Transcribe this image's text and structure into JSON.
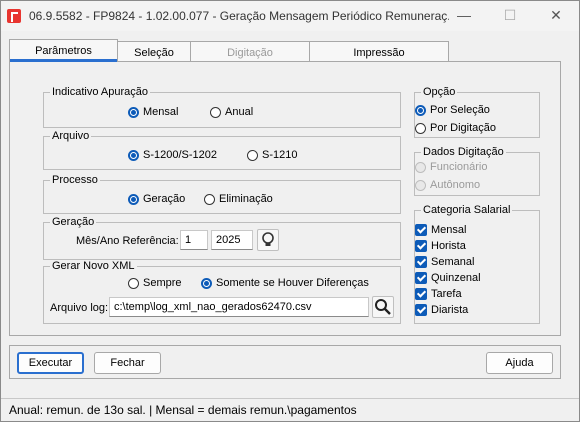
{
  "window": {
    "title": "06.9.5582 - FP9824 - 1.02.00.077 - Geração Mensagem Periódico Remuneraç...",
    "minimize": "—",
    "maximize": "☐",
    "close": "✕"
  },
  "tabs": [
    {
      "label": "Parâmetros",
      "state": "active"
    },
    {
      "label": "Seleção",
      "state": "normal"
    },
    {
      "label": "Digitação",
      "state": "disabled"
    },
    {
      "label": "Impressão",
      "state": "normal"
    }
  ],
  "indicativo": {
    "legend": "Indicativo Apuração",
    "options": [
      {
        "label": "Mensal",
        "selected": true
      },
      {
        "label": "Anual",
        "selected": false
      }
    ]
  },
  "arquivo": {
    "legend": "Arquivo",
    "options": [
      {
        "label": "S-1200/S-1202",
        "selected": true
      },
      {
        "label": "S-1210",
        "selected": false
      }
    ]
  },
  "processo": {
    "legend": "Processo",
    "options": [
      {
        "label": "Geração",
        "selected": true
      },
      {
        "label": "Eliminação",
        "selected": false
      }
    ]
  },
  "geracao": {
    "legend": "Geração",
    "ref_label": "Mês/Ano Referência:",
    "month": "1",
    "year": "2025",
    "lookup_icon": "bulb-icon"
  },
  "xml": {
    "legend": "Gerar Novo XML",
    "options": [
      {
        "label": "Sempre",
        "selected": false
      },
      {
        "label": "Somente se Houver Diferenças",
        "selected": true
      }
    ],
    "log_label": "Arquivo log:",
    "log_path": "c:\\temp\\log_xml_nao_gerados62470.csv",
    "search_icon": "search-icon"
  },
  "opcao": {
    "legend": "Opção",
    "options": [
      {
        "label": "Por Seleção",
        "selected": true
      },
      {
        "label": "Por Digitação",
        "selected": false
      }
    ]
  },
  "dados": {
    "legend": "Dados Digitação",
    "options": [
      {
        "label": "Funcionário",
        "selected": true,
        "disabled": true
      },
      {
        "label": "Autônomo",
        "selected": false,
        "disabled": true
      }
    ]
  },
  "categoria": {
    "legend": "Categoria Salarial",
    "items": [
      {
        "label": "Mensal",
        "checked": true
      },
      {
        "label": "Horista",
        "checked": true
      },
      {
        "label": "Semanal",
        "checked": true
      },
      {
        "label": "Quinzenal",
        "checked": true
      },
      {
        "label": "Tarefa",
        "checked": true
      },
      {
        "label": "Diarista",
        "checked": true
      }
    ]
  },
  "buttons": {
    "execute": "Executar",
    "close": "Fechar",
    "help": "Ajuda"
  },
  "status": "Anual: remun. de 13o sal. | Mensal = demais remun.\\pagamentos",
  "colors": {
    "accent": "#0d5bb8",
    "tab_underline": "#2a6fcf",
    "app_icon": "#e83530"
  }
}
